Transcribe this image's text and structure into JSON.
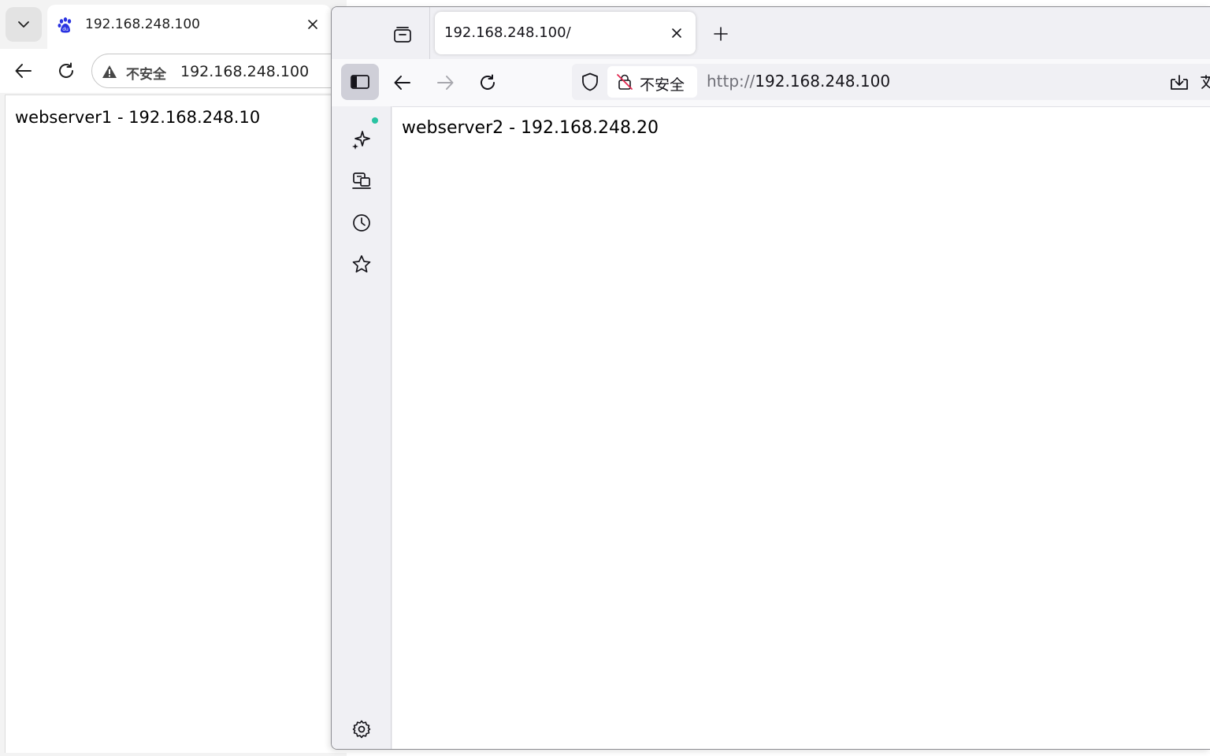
{
  "left_browser": {
    "tab": {
      "title": "192.168.248.100"
    },
    "address_bar": {
      "security_label": "不安全",
      "url": "192.168.248.100"
    },
    "page": {
      "text": "webserver1 - 192.168.248.10"
    }
  },
  "right_browser": {
    "tab": {
      "title": "192.168.248.100/"
    },
    "address_bar": {
      "security_label": "不安全",
      "url_scheme": "http://",
      "url_host": "192.168.248.100"
    },
    "page": {
      "text": "webserver2 - 192.168.248.20"
    },
    "sidebar": {
      "items": [
        {
          "icon": "ai-sparkle-icon"
        },
        {
          "icon": "synced-devices-icon"
        },
        {
          "icon": "history-icon"
        },
        {
          "icon": "bookmarks-star-icon"
        }
      ],
      "footer_icon": "settings-gear-icon"
    }
  },
  "colors": {
    "firefox_chrome": "#f0f0f4",
    "sidebar_active": "#cfcfd8",
    "notification_dot": "#2ac3a2",
    "baidu_blue": "#2932e1"
  }
}
